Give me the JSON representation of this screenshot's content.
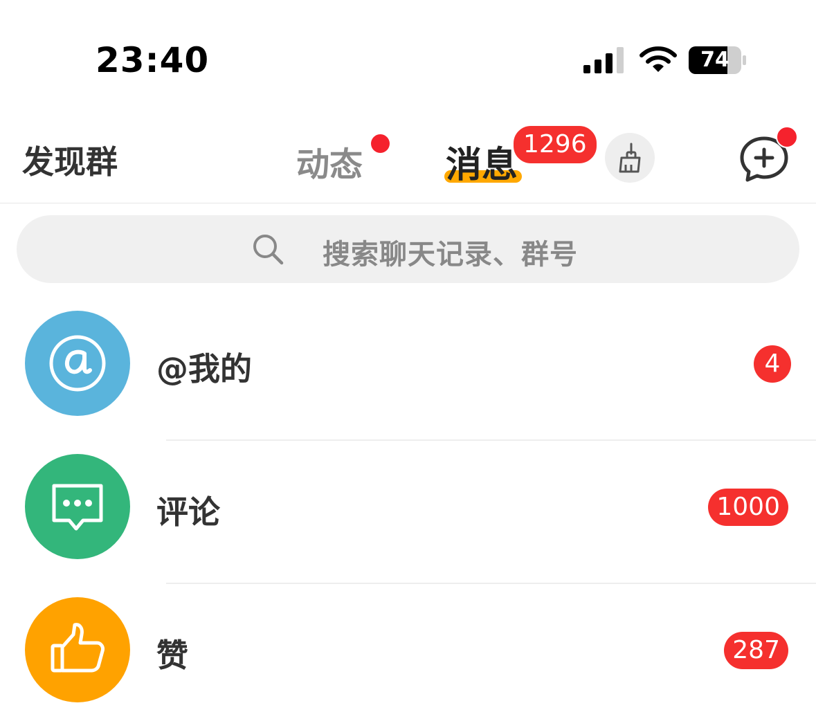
{
  "status_bar": {
    "time": "23:40",
    "battery": "74"
  },
  "header": {
    "discover_groups": "发现群",
    "tabs": [
      {
        "label": "动态",
        "active": false,
        "has_dot": true
      },
      {
        "label": "消息",
        "active": true,
        "badge": "1296"
      }
    ],
    "clean_icon": "broom-icon",
    "new_chat_icon": "chat-plus-icon",
    "accent_color": "#ffa800",
    "badge_color": "#f5302e"
  },
  "search": {
    "placeholder": "搜索聊天记录、群号"
  },
  "list": [
    {
      "label": "@我的",
      "badge": "4",
      "icon": "at-icon",
      "color": "#5ab4dc"
    },
    {
      "label": "评论",
      "badge": "1000",
      "icon": "comment-icon",
      "color": "#33b67b"
    },
    {
      "label": "赞",
      "badge": "287",
      "icon": "thumbs-up-icon",
      "color": "#ffa200"
    }
  ]
}
